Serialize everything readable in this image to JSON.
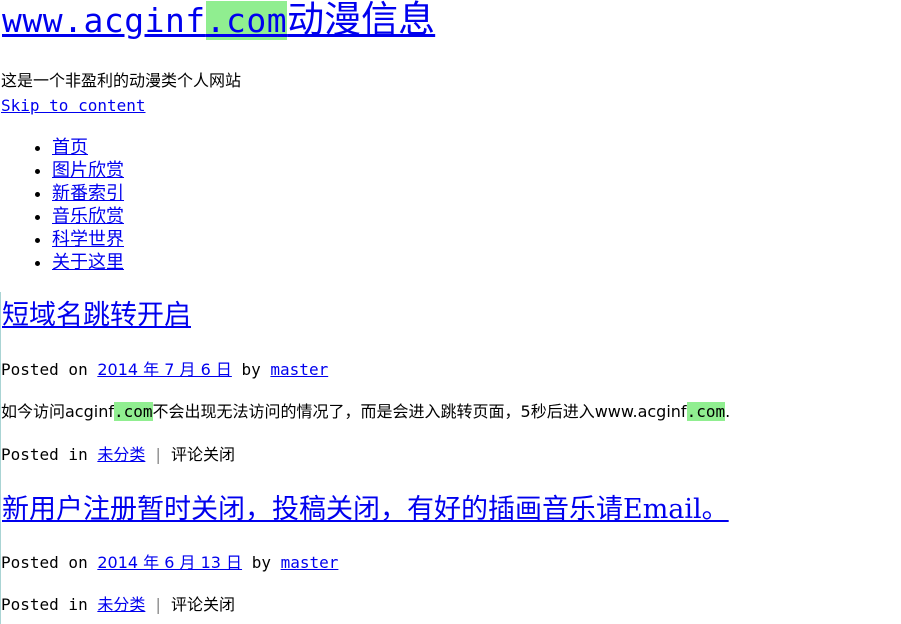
{
  "site": {
    "title_domain_prefix": "www.acginf",
    "title_domain_hl": ".com",
    "title_suffix": "动漫信息",
    "tagline": "这是一个非盈利的动漫类个人网站",
    "skip_link": "Skip to content"
  },
  "nav": {
    "items": [
      {
        "label": "首页"
      },
      {
        "label": "图片欣赏"
      },
      {
        "label": "新番索引"
      },
      {
        "label": "音乐欣赏"
      },
      {
        "label": "科学世界"
      },
      {
        "label": "关于这里"
      }
    ]
  },
  "posts": [
    {
      "title": "短域名跳转开启",
      "posted_on_label": "Posted on",
      "date": "2014 年 7 月 6 日",
      "by_label": "by",
      "author": "master",
      "content": {
        "p1": "如今访问acginf",
        "hl1": ".com",
        "p2": "不会出现无法访问的情况了，而是会进入跳转页面，5秒后进入www.acginf",
        "hl2": ".com",
        "p3": "."
      },
      "posted_in_label": "Posted in",
      "category": "未分类",
      "separator": "|",
      "comments": "评论关闭"
    },
    {
      "title": "新用户注册暂时关闭，投稿关闭，有好的插画音乐请Email。",
      "posted_on_label": "Posted on",
      "date": "2014 年 6 月 13 日",
      "by_label": "by",
      "author": "master",
      "posted_in_label": "Posted in",
      "category": "未分类",
      "separator": "|",
      "comments": "评论关闭"
    }
  ]
}
